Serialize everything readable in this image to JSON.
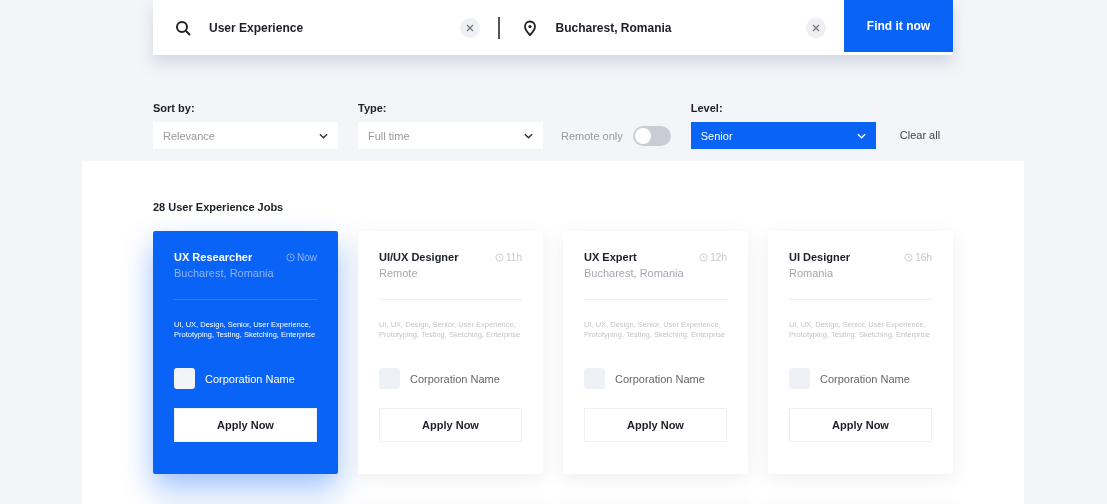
{
  "search": {
    "query": "User Experience",
    "location": "Bucharest, Romania",
    "button": "Find it now"
  },
  "filters": {
    "sort": {
      "label": "Sort by:",
      "value": "Relevance"
    },
    "type": {
      "label": "Type:",
      "value": "Full time"
    },
    "remote": {
      "label": "Remote only",
      "on": false
    },
    "level": {
      "label": "Level:",
      "value": "Senior",
      "active": true
    },
    "clear": "Clear all"
  },
  "results_title": "28 User Experience Jobs",
  "jobs": [
    {
      "title": "UX Researcher",
      "time": "Now",
      "location": "Bucharest, Romania",
      "tags": "UI, UX, Design, Senior, User Experience, Prototyping, Testing, Sketching, Enterprise",
      "company": "Corporation Name",
      "button": "Apply Now",
      "selected": true
    },
    {
      "title": "UI/UX Designer",
      "time": "11h",
      "location": "Remote",
      "tags": "UI, UX, Design, Senior, User Experience, Prototyping, Testing, Sketching, Enterprise",
      "company": "Corporation Name",
      "button": "Apply Now",
      "selected": false
    },
    {
      "title": "UX Expert",
      "time": "12h",
      "location": "Bucharest, Romania",
      "tags": "UI, UX, Design, Senior, User Experience, Prototyping, Testing, Sketching, Enterprise",
      "company": "Corporation Name",
      "button": "Apply Now",
      "selected": false
    },
    {
      "title": "UI Designer",
      "time": "16h",
      "location": "Romania",
      "tags": "UI, UX, Design, Senior, User Experience, Prototyping, Testing, Sketching, Enterprise",
      "company": "Corporation Name",
      "button": "Apply Now",
      "selected": false
    }
  ]
}
